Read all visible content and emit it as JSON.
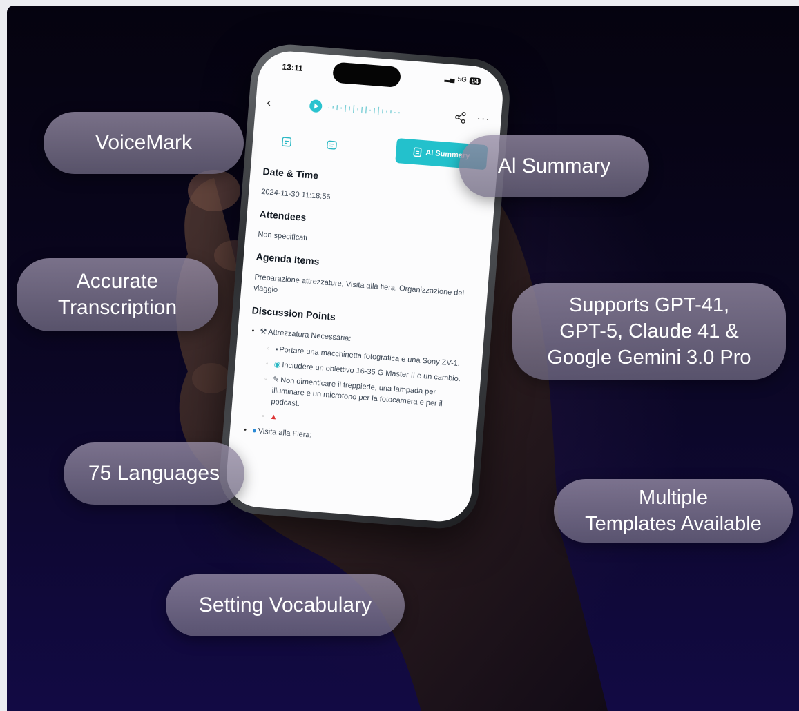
{
  "features": {
    "voicemark": "VoiceMark",
    "ai_summary": "Al Summary",
    "accurate_line1": "Accurate",
    "accurate_line2": "Transcription",
    "supports_line1": "Supports GPT-41,",
    "supports_line2": "GPT-5, Claude 41 &",
    "supports_line3": "Google Gemini 3.0 Pro",
    "languages": "75 Languages",
    "templates_line1": "Multiple",
    "templates_line2": "Templates Available",
    "vocabulary": "Setting Vocabulary"
  },
  "phone": {
    "status_time": "13:11",
    "network": "5G",
    "battery": "84",
    "tab_active_label": "Al Summary",
    "summary": {
      "date_heading": "Date & Time",
      "date_value": "2024-11-30 11:18:56",
      "attendees_heading": "Attendees",
      "attendees_value": "Non specificati",
      "agenda_heading": "Agenda Items",
      "agenda_value": "Preparazione attrezzature, Visita alla fiera, Organizzazione del viaggio",
      "discussion_heading": "Discussion Points",
      "point1": "Attrezzatura Necessaria:",
      "sub1": "Portare una macchinetta fotografica e una Sony ZV-1.",
      "sub2": "Includere un obiettivo 16-35 G Master II e un cambio.",
      "sub3": "Non dimenticare il treppiede, una lampada per illuminare e un microfono per la fotocamera e per il podcast.",
      "point2": "Visita alla Fiera:"
    }
  },
  "colors": {
    "accent": "#23c1cc",
    "background_top": "#05030f",
    "background_bottom": "#120a44"
  },
  "icons": [
    "back-icon",
    "play-icon",
    "waveform-icon",
    "share-icon",
    "more-icon",
    "document-icon",
    "transcript-icon",
    "summary-icon",
    "tools-icon",
    "camera-icon",
    "lens-icon",
    "microphone-icon",
    "circus-icon",
    "globe-icon"
  ]
}
